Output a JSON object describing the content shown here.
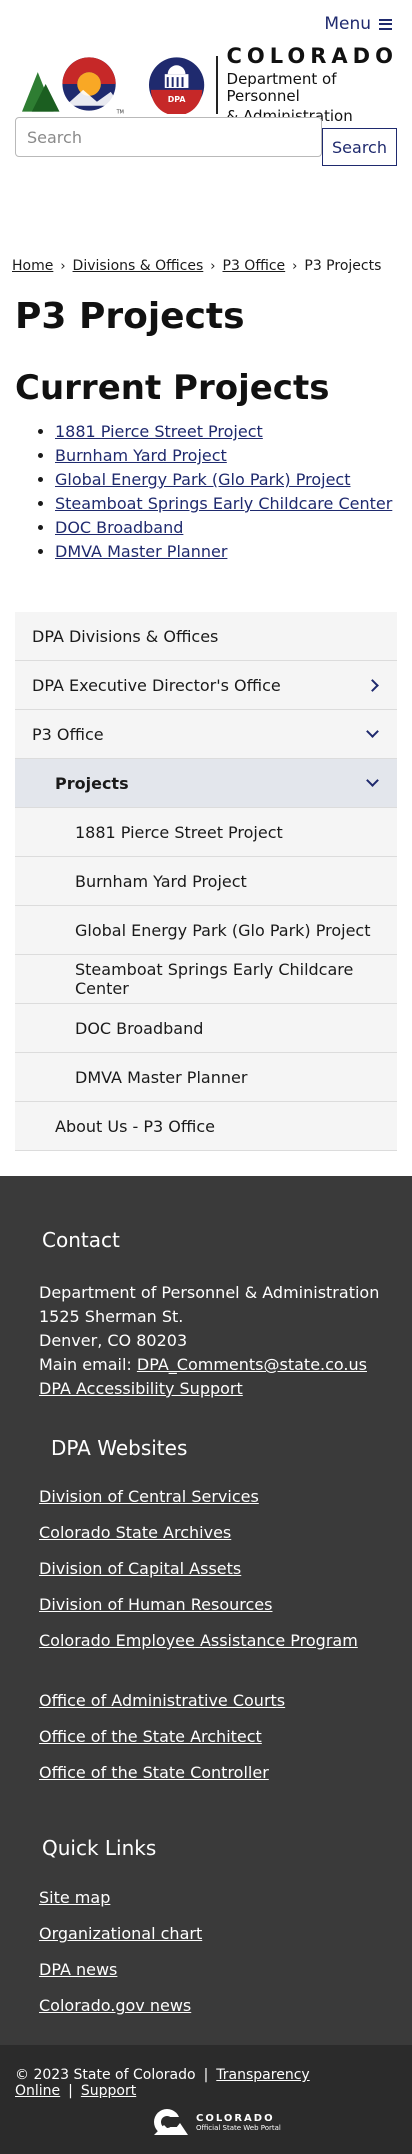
{
  "header": {
    "menu_label": "Menu",
    "logo_colorado": "COLORADO",
    "logo_dept_line1": "Department of Personnel",
    "logo_dept_line2": "& Administration",
    "seal_text": "DPA",
    "tm": "TM",
    "search_placeholder": "Search",
    "search_button": "Search"
  },
  "breadcrumb": {
    "items": [
      "Home",
      "Divisions & Offices",
      "P3 Office"
    ],
    "current": "P3 Projects",
    "separator": "›"
  },
  "page_title": "P3 Projects",
  "section_title": "Current Projects",
  "projects": [
    "1881 Pierce Street Project",
    "Burnham Yard Project",
    "Global Energy Park (Glo Park) Project",
    "Steamboat Springs Early Childcare Center",
    "DOC Broadband",
    "DMVA Master Planner"
  ],
  "sidenav": {
    "divisions": "DPA Divisions & Offices",
    "exec_office": "DPA Executive Director's Office",
    "p3_office": "P3 Office",
    "projects": "Projects",
    "project_items": [
      "1881 Pierce Street Project",
      "Burnham Yard Project",
      "Global Energy Park (Glo Park) Project",
      "Steamboat Springs Early Childcare Center",
      "DOC Broadband",
      "DMVA Master Planner"
    ],
    "about": "About Us - P3 Office"
  },
  "footer": {
    "contact_title": "Contact",
    "address_line1": "Department of Personnel & Administration",
    "address_line2": "1525 Sherman St.",
    "address_line3": "Denver, CO 80203",
    "email_label": "Main email: ",
    "email": "DPA_Comments@state.co.us",
    "accessibility": "DPA Accessibility Support",
    "websites_title": "DPA Websites",
    "websites_group1": [
      "Division of Central Services",
      "Colorado State Archives",
      "Division of Capital Assets",
      "Division of Human Resources",
      "Colorado Employee Assistance Program"
    ],
    "websites_group2": [
      "Office of Administrative Courts",
      "Office of the State Architect",
      "Office of the State Controller"
    ],
    "quick_links_title": "Quick Links",
    "quick_links": [
      "Site map",
      "Organizational chart",
      "DPA news",
      "Colorado.gov news"
    ]
  },
  "bottom_bar": {
    "copyright": "© 2023 State of Colorado",
    "transparency": "Transparency Online",
    "support": "Support",
    "portal_line1": "COLORADO",
    "portal_line2": "Official State Web Portal"
  },
  "colors": {
    "brand_navy": "#1f2a6e",
    "footer_bg": "#3a3a3a",
    "bottom_bg": "#2b2b2b",
    "nav_bg": "#f5f5f5",
    "nav_active_bg": "#e3e6ec"
  }
}
